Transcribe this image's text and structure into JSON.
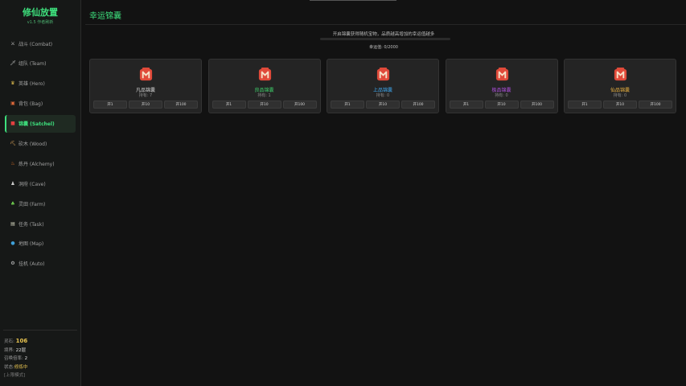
{
  "app": {
    "title": "修仙放置",
    "version": "v1.5 作者刷新"
  },
  "nav": [
    {
      "label": "战斗 (Combat)",
      "icon": "crossed-swords-icon",
      "glyph": "⚔",
      "color": "#d0d0d0",
      "active": false
    },
    {
      "label": "组队 (Team)",
      "icon": "sword-icon",
      "glyph": "🗡",
      "color": "#c0c0c0",
      "active": false
    },
    {
      "label": "英雄 (Hero)",
      "icon": "crown-icon",
      "glyph": "♛",
      "color": "#e8c451",
      "active": false
    },
    {
      "label": "背包 (Bag)",
      "icon": "backpack-icon",
      "glyph": "▣",
      "color": "#e26a3a",
      "active": false
    },
    {
      "label": "锦囊 (Satchel)",
      "icon": "satchel-icon",
      "glyph": "■",
      "color": "#e24040",
      "active": true
    },
    {
      "label": "砍木 (Wood)",
      "icon": "axe-icon",
      "glyph": "⛏",
      "color": "#d9a35a",
      "active": false
    },
    {
      "label": "炼丹 (Alchemy)",
      "icon": "flame-icon",
      "glyph": "♨",
      "color": "#f07a2a",
      "active": false
    },
    {
      "label": "洞府 (Cave)",
      "icon": "person-icon",
      "glyph": "♟",
      "color": "#d0d0d0",
      "active": false
    },
    {
      "label": "灵田 (Farm)",
      "icon": "sprout-icon",
      "glyph": "♣",
      "color": "#6fcf4f",
      "active": false
    },
    {
      "label": "任务 (Task)",
      "icon": "scroll-icon",
      "glyph": "▤",
      "color": "#d8d8c0",
      "active": false
    },
    {
      "label": "地图 (Map)",
      "icon": "globe-icon",
      "glyph": "●",
      "color": "#3fa0d8",
      "active": false
    },
    {
      "label": "挂机 (Auto)",
      "icon": "gear-icon",
      "glyph": "⚙",
      "color": "#d0d0d0",
      "active": false
    }
  ],
  "stats": {
    "spirit_stone_label": "灵石:",
    "spirit_stone_value": "106",
    "level_label": "境界:",
    "level_value": "22层",
    "wait_label": "召唤倍率:",
    "wait_value": "2",
    "status_label": "状态:",
    "status_value": "修炼中",
    "footer": "[上限模式]"
  },
  "page": {
    "title": "幸运锦囊",
    "description": "开启锦囊获得随机宝物，品质越高增加的幸运值越多",
    "luck_label": "幸运值: 0/2000",
    "luck_fraction": 0
  },
  "satchels": [
    {
      "name": "凡品锦囊",
      "holding": "持有: 7",
      "color": "#d8d8d8",
      "buttons": [
        "开1",
        "开10",
        "开100"
      ]
    },
    {
      "name": "良品锦囊",
      "holding": "持有: 1",
      "color": "#3ecf6a",
      "buttons": [
        "开1",
        "开10",
        "开100"
      ]
    },
    {
      "name": "上品锦囊",
      "holding": "持有: 0",
      "color": "#3fa8ef",
      "buttons": [
        "开1",
        "开10",
        "开100"
      ]
    },
    {
      "name": "极品锦囊",
      "holding": "持有: 0",
      "color": "#b050e0",
      "buttons": [
        "开1",
        "开10",
        "开100"
      ]
    },
    {
      "name": "仙品锦囊",
      "holding": "持有: 0",
      "color": "#e8b040",
      "buttons": [
        "开1",
        "开10",
        "开100"
      ]
    }
  ],
  "colors": {
    "accent": "#3ee07d",
    "bag_red": "#e04a3a",
    "bag_cream": "#f6e0c8"
  }
}
